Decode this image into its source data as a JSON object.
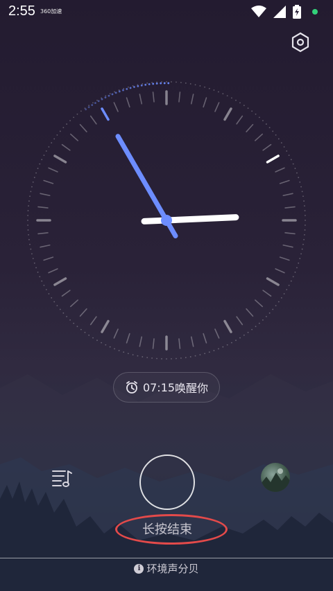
{
  "status_bar": {
    "time": "2:55",
    "badge": "360加速"
  },
  "clock": {
    "hour": 2,
    "minute": 55,
    "accent_color": "#6d8dff"
  },
  "alarm": {
    "time": "07:15",
    "suffix": "唤醒你"
  },
  "controls": {
    "hint": "长按结束"
  },
  "footer": {
    "info_icon_glyph": "i",
    "text": "环境声分贝"
  },
  "colors": {
    "highlight": "#e34a4a",
    "status_dot": "#33d17a"
  }
}
